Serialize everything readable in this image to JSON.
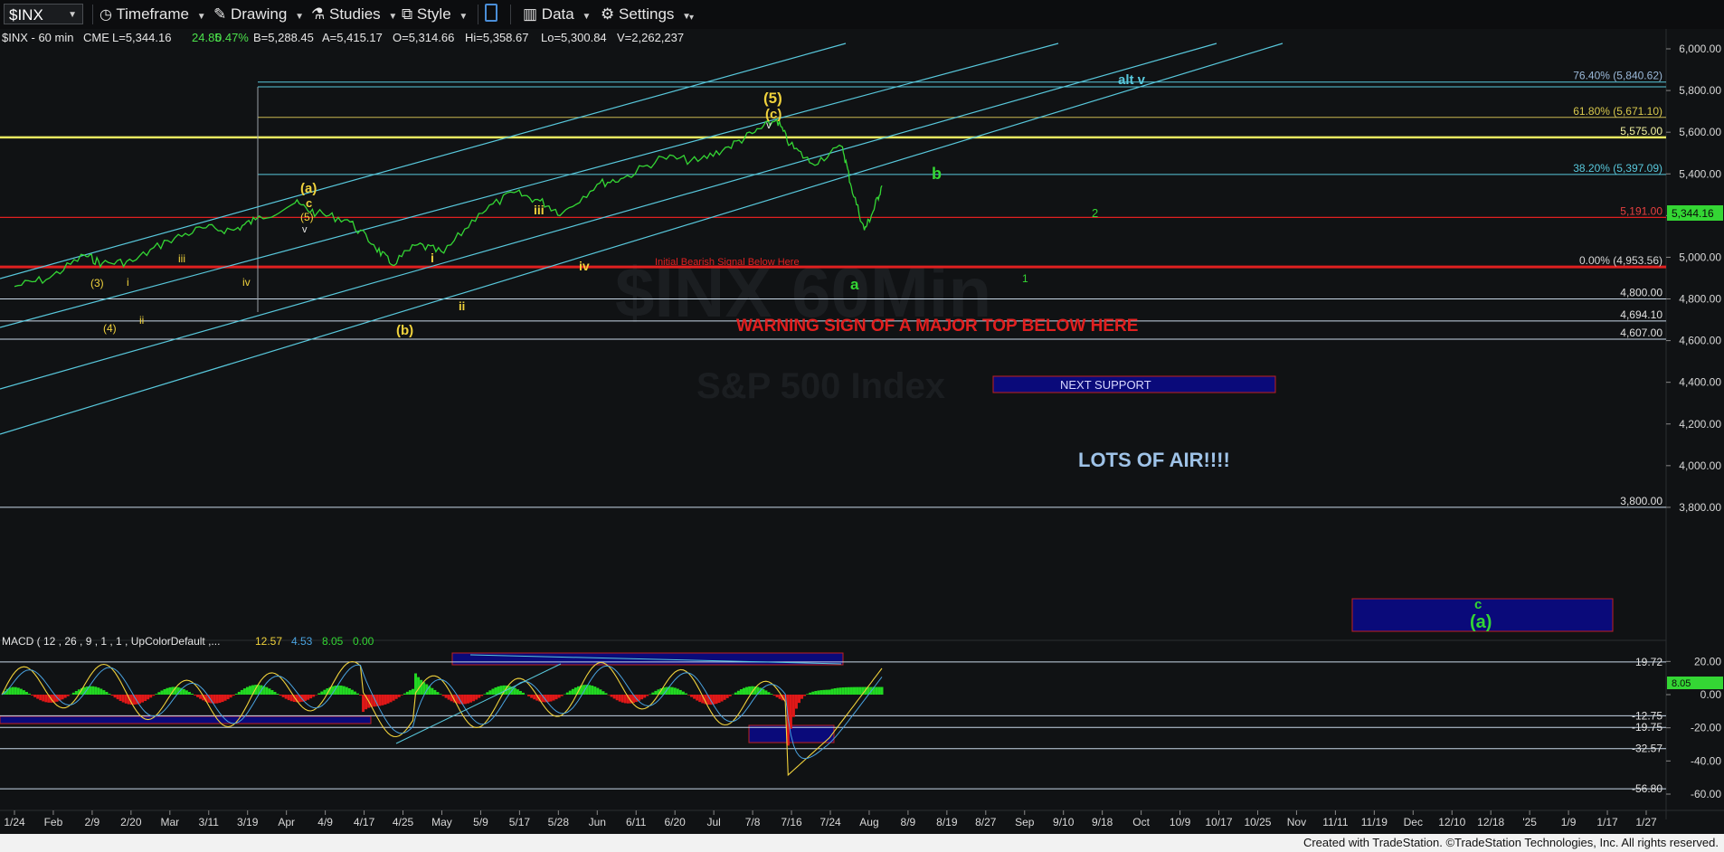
{
  "toolbar": {
    "symbol": "$INX",
    "timeframe": "Timeframe",
    "drawing": "Drawing",
    "studies": "Studies",
    "style": "Style",
    "data": "Data",
    "settings": "Settings"
  },
  "info_line": {
    "symbol": "$INX - 60 min",
    "exchange": "CME",
    "last": "L=5,344.16",
    "change": "24.85",
    "change_pct": "0.47%",
    "bid": "B=5,288.45",
    "ask": "A=5,415.17",
    "open": "O=5,314.66",
    "high": "Hi=5,358.67",
    "low": "Lo=5,300.84",
    "volume": "V=2,262,237"
  },
  "watermark": {
    "line1": "$INX 60Min",
    "line2": "S&P 500 Index"
  },
  "macd_header": {
    "label": "MACD ( 12 , 26 , 9 , 1 , 1 , UpColorDefault ,...",
    "v1": "12.57",
    "v2": "4.53",
    "v3": "8.05",
    "v4": "0.00"
  },
  "footer": "Created with TradeStation. ©TradeStation Technologies, Inc. All rights reserved.",
  "colors": {
    "background": "#101214",
    "price": "#34d634",
    "macd_line": "#f0d23c",
    "signal_line": "#4aa3e0",
    "hist_up": "#22d922",
    "hist_down": "#e01818",
    "channel": "#58c8dc",
    "yellow_level": "#e8e860",
    "red_level": "#e02020",
    "support_box": "#0a0a7a"
  },
  "chart_data": {
    "type": "line",
    "title": "$INX - 60 min",
    "price_axis": {
      "ticks": [
        "6,000.00",
        "5,800.00",
        "5,600.00",
        "5,400.00",
        "5,200.00",
        "5,000.00",
        "4,800.00",
        "4,600.00",
        "4,400.00",
        "4,200.00",
        "4,000.00",
        "3,800.00"
      ],
      "last_price": "5,344.16"
    },
    "macd_axis": {
      "ticks": [
        "20.00",
        "0.00",
        "-20.00",
        "-40.00",
        "-60.00"
      ],
      "last_value": "8.05"
    },
    "x_labels": [
      "1/24",
      "Feb",
      "2/9",
      "2/20",
      "Mar",
      "3/11",
      "3/19",
      "Apr",
      "4/9",
      "4/17",
      "4/25",
      "May",
      "5/9",
      "5/17",
      "5/28",
      "Jun",
      "6/11",
      "6/20",
      "Jul",
      "7/8",
      "7/16",
      "7/24",
      "Aug",
      "8/9",
      "8/19",
      "8/27",
      "Sep",
      "9/10",
      "9/18",
      "Oct",
      "10/9",
      "10/17",
      "10/25",
      "Nov",
      "11/11",
      "11/19",
      "Dec",
      "12/10",
      "12/18",
      "'25",
      "1/9",
      "1/17",
      "1/27"
    ],
    "price_series": [
      [
        "1/24",
        4860
      ],
      [
        "2/1",
        4900
      ],
      [
        "2/9",
        5010
      ],
      [
        "2/13",
        4970
      ],
      [
        "2/20",
        4980
      ],
      [
        "2/28",
        5080
      ],
      [
        "3/7",
        5140
      ],
      [
        "3/14",
        5130
      ],
      [
        "3/19",
        5180
      ],
      [
        "3/28",
        5260
      ],
      [
        "4/2",
        5210
      ],
      [
        "4/9",
        5180
      ],
      [
        "4/15",
        5060
      ],
      [
        "4/19",
        4965
      ],
      [
        "4/25",
        5060
      ],
      [
        "5/1",
        5020
      ],
      [
        "5/9",
        5210
      ],
      [
        "5/17",
        5310
      ],
      [
        "5/23",
        5270
      ],
      [
        "5/28",
        5210
      ],
      [
        "6/5",
        5350
      ],
      [
        "6/11",
        5380
      ],
      [
        "6/20",
        5480
      ],
      [
        "6/28",
        5460
      ],
      [
        "7/5",
        5530
      ],
      [
        "7/11",
        5600
      ],
      [
        "7/16",
        5660
      ],
      [
        "7/19",
        5540
      ],
      [
        "7/24",
        5450
      ],
      [
        "7/31",
        5530
      ],
      [
        "8/2",
        5340
      ],
      [
        "8/5",
        5130
      ],
      [
        "8/7",
        5220
      ],
      [
        "8/9",
        5344
      ]
    ],
    "levels": [
      {
        "value": 5840.62,
        "label": "76.40% (5,840.62)"
      },
      {
        "value": 5671.1,
        "label": "61.80% (5,671.10)"
      },
      {
        "value": 5575.0,
        "label": "5,575.00"
      },
      {
        "value": 5397.09,
        "label": "38.20% (5,397.09)"
      },
      {
        "value": 5191.0,
        "label": "5,191.00"
      },
      {
        "value": 4953.56,
        "label": "0.00% (4,953.56)"
      },
      {
        "value": 4800.0,
        "label": "4,800.00"
      },
      {
        "value": 4694.1,
        "label": "4,694.10"
      },
      {
        "value": 4607.0,
        "label": "4,607.00"
      },
      {
        "value": 3800.0,
        "label": "3,800.00"
      }
    ],
    "macd_levels": [
      {
        "value": 19.72,
        "label": "19.72"
      },
      {
        "value": -12.75,
        "label": "-12.75"
      },
      {
        "value": -19.75,
        "label": "-19.75"
      },
      {
        "value": -32.57,
        "label": "-32.57"
      },
      {
        "value": -56.8,
        "label": "-56.80"
      }
    ],
    "annotations": {
      "warning": "WARNING SIGN OF A MAJOR TOP BELOW HERE",
      "initial_bearish": "Initial Bearish Signal Below Here",
      "next_support": "NEXT SUPPORT",
      "lots_of_air": "LOTS OF AIR!!!!",
      "alt_v": "alt v",
      "wave_b": "b",
      "wave_2": "2",
      "wave_1": "1",
      "wave_a": "a",
      "wave_c": "c",
      "wave_a_paren": "(a)",
      "yellow_5_paren": "(5)",
      "yellow_c_paren": "(c)",
      "yellow_v_top": "v",
      "yellow_a_paren": "(a)",
      "yellow_c": "c",
      "yellow_5_small": "(5)",
      "yellow_v_small": "v",
      "yellow_3": "(3)",
      "yellow_4": "(4)",
      "yellow_i_feb": "i",
      "yellow_ii_feb": "ii",
      "yellow_iii_mar": "iii",
      "yellow_iv_mar": "iv",
      "yellow_b_paren": "(b)",
      "yellow_i_may": "i",
      "yellow_ii_may": "ii",
      "yellow_iii_may": "iii",
      "yellow_iv_jun": "iv"
    }
  }
}
